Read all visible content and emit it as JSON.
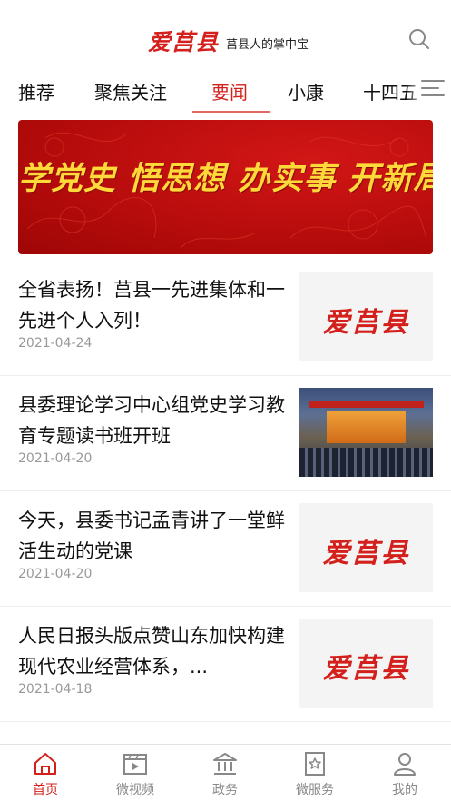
{
  "header": {
    "logo_text": "爱莒县",
    "slogan": "莒县人的掌中宝"
  },
  "tabs": [
    {
      "label": "推荐",
      "active": false
    },
    {
      "label": "聚焦关注",
      "active": false
    },
    {
      "label": "要闻",
      "active": true
    },
    {
      "label": "小康",
      "active": false
    },
    {
      "label": "十四五",
      "active": false
    }
  ],
  "banner": {
    "text": "学党史 悟思想 办实事 开新局"
  },
  "news": [
    {
      "title": "全省表扬！莒县一先进集体和一先进个人入列！",
      "date": "2021-04-24",
      "thumb": "logo",
      "thumb_text": "爱莒县"
    },
    {
      "title": "县委理论学习中心组党史学习教育专题读书班开班",
      "date": "2021-04-20",
      "thumb": "photo"
    },
    {
      "title": "今天，县委书记孟青讲了一堂鲜活生动的党课",
      "date": "2021-04-20",
      "thumb": "logo",
      "thumb_text": "爱莒县"
    },
    {
      "title": "人民日报头版点赞山东加快构建现代农业经营体系，...",
      "date": "2021-04-18",
      "thumb": "logo",
      "thumb_text": "爱莒县"
    }
  ],
  "bottom_nav": [
    {
      "label": "首页",
      "icon": "home-icon",
      "active": true
    },
    {
      "label": "微视频",
      "icon": "video-icon",
      "active": false
    },
    {
      "label": "政务",
      "icon": "government-icon",
      "active": false
    },
    {
      "label": "微服务",
      "icon": "service-icon",
      "active": false
    },
    {
      "label": "我的",
      "icon": "profile-icon",
      "active": false
    }
  ],
  "colors": {
    "accent": "#d4201c",
    "banner_red": "#c01010",
    "banner_text": "#ffd83a",
    "muted": "#999999"
  }
}
